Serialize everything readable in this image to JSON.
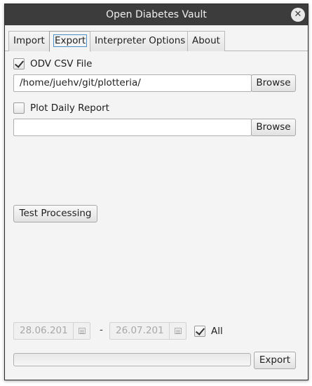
{
  "window": {
    "title": "Open Diabetes Vault",
    "close_icon": "close-icon"
  },
  "tabs": [
    {
      "label": "Import",
      "active": false
    },
    {
      "label": "Export",
      "active": true
    },
    {
      "label": "Interpreter Options",
      "active": false
    },
    {
      "label": "About",
      "active": false
    }
  ],
  "odv_csv": {
    "label": "ODV CSV File",
    "checked": true,
    "path": "/home/juehv/git/plotteria/",
    "browse_label": "Browse"
  },
  "daily_report": {
    "label": "Plot Daily Report",
    "checked": false,
    "path": "",
    "browse_label": "Browse"
  },
  "test_processing_label": "Test Processing",
  "date_range": {
    "from": "28.06.201",
    "to": "26.07.201",
    "separator": "-",
    "all_label": "All",
    "all_checked": true
  },
  "progress": {
    "value": 0
  },
  "export_label": "Export"
}
